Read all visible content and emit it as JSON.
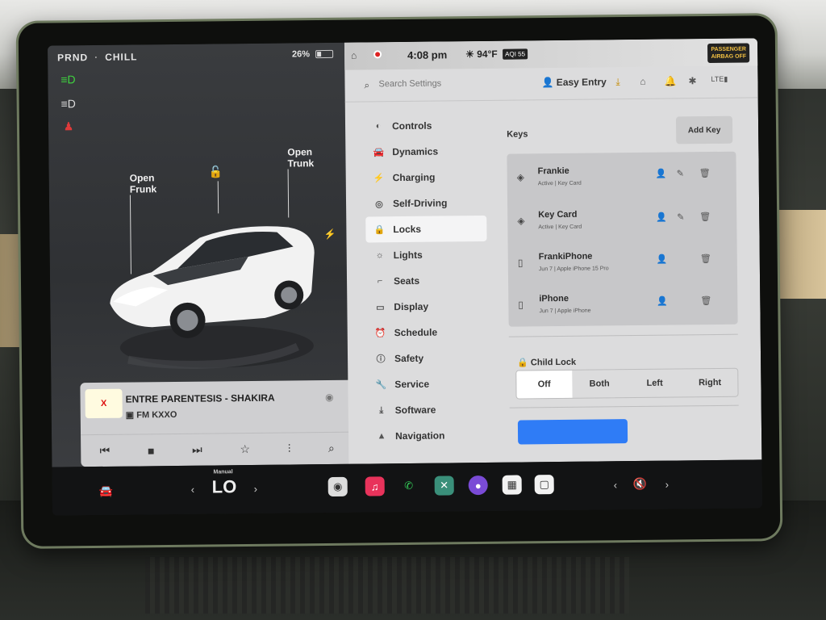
{
  "status_bar": {
    "gear": "PRND",
    "mode": "CHILL",
    "battery_pct": "26%",
    "battery_level": 0.26
  },
  "car_view": {
    "frunk_label_line1": "Open",
    "frunk_label_line2": "Frunk",
    "trunk_label_line1": "Open",
    "trunk_label_line2": "Trunk"
  },
  "media": {
    "station_logo": "X",
    "title": "ENTRE PARENTESIS - SHAKIRA",
    "station": "FM KXXO"
  },
  "top_strip": {
    "time": "4:08 pm",
    "temperature": "94°F",
    "aqi": "AQI 55",
    "airbag_line1": "PASSENGER",
    "airbag_line2": "AIRBAG OFF"
  },
  "search": {
    "placeholder": "Search Settings",
    "profile": "Easy Entry"
  },
  "nav": {
    "items": [
      {
        "label": "Controls",
        "icon": "toggle-icon"
      },
      {
        "label": "Dynamics",
        "icon": "car-icon"
      },
      {
        "label": "Charging",
        "icon": "bolt-icon"
      },
      {
        "label": "Self-Driving",
        "icon": "steering-wheel-icon"
      },
      {
        "label": "Locks",
        "icon": "lock-icon"
      },
      {
        "label": "Lights",
        "icon": "sun-icon"
      },
      {
        "label": "Seats",
        "icon": "seat-icon"
      },
      {
        "label": "Display",
        "icon": "display-icon"
      },
      {
        "label": "Schedule",
        "icon": "clock-icon"
      },
      {
        "label": "Safety",
        "icon": "info-icon"
      },
      {
        "label": "Service",
        "icon": "wrench-icon"
      },
      {
        "label": "Software",
        "icon": "download-icon"
      },
      {
        "label": "Navigation",
        "icon": "navigation-icon"
      }
    ],
    "active": "Locks"
  },
  "keys": {
    "title": "Keys",
    "add_button": "Add Key",
    "list": [
      {
        "name": "Frankie",
        "sub": "Active | Key Card"
      },
      {
        "name": "Key Card",
        "sub": "Active | Key Card"
      },
      {
        "name": "FrankiPhone",
        "sub": "Jun 7 | Apple iPhone 15 Pro"
      },
      {
        "name": "iPhone",
        "sub": "Jun 7 | Apple iPhone"
      }
    ]
  },
  "child_lock": {
    "title": "Child Lock",
    "options": [
      "Off",
      "Both",
      "Left",
      "Right"
    ],
    "selected": "Off"
  },
  "dock": {
    "temp_mode": "Manual",
    "temp": "LO"
  }
}
